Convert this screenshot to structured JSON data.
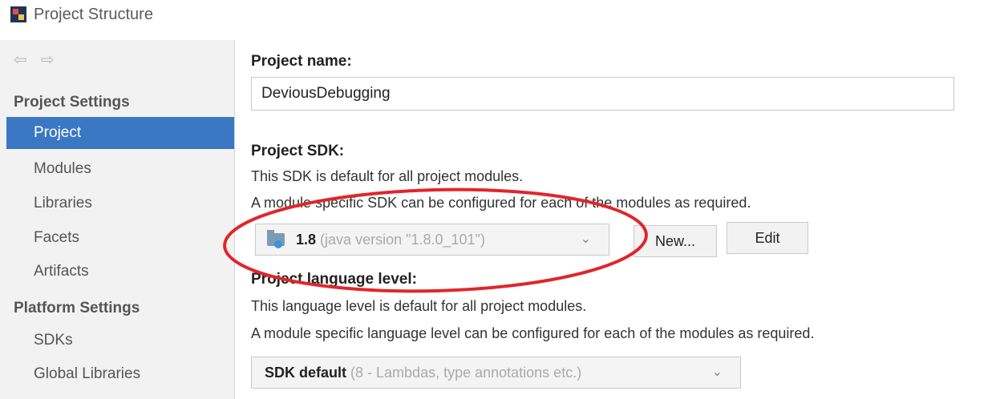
{
  "window": {
    "title": "Project Structure"
  },
  "nav": {
    "back": "⇦",
    "forward": "⇨"
  },
  "sidebar": {
    "project_settings_heading": "Project Settings",
    "project_items": [
      "Project",
      "Modules",
      "Libraries",
      "Facets",
      "Artifacts"
    ],
    "platform_settings_heading": "Platform Settings",
    "platform_items": [
      "SDKs",
      "Global Libraries"
    ],
    "selected": "Project"
  },
  "main": {
    "project_name_label": "Project name:",
    "project_name_value": "DeviousDebugging",
    "sdk_label": "Project SDK:",
    "sdk_desc_1": "This SDK is default for all project modules.",
    "sdk_desc_2": "A module specific SDK can be configured for each of the modules as required.",
    "sdk_selected": "1.8",
    "sdk_detail": "(java version \"1.8.0_101\")",
    "new_button": "New...",
    "edit_button": "Edit",
    "lang_label": "Project language level:",
    "lang_desc_1": "This language level is default for all project modules.",
    "lang_desc_2": "A module specific language level can be configured for each of the modules as required.",
    "lang_selected": "SDK default",
    "lang_detail": "(8 - Lambdas, type annotations etc.)"
  },
  "colors": {
    "selection": "#3b78c3",
    "annotation": "#e0262b",
    "sidebar_bg": "#f2f2f2"
  },
  "icons": [
    "app-icon",
    "back-arrow-icon",
    "forward-arrow-icon",
    "sdk-folder-icon",
    "chevron-down-icon"
  ]
}
